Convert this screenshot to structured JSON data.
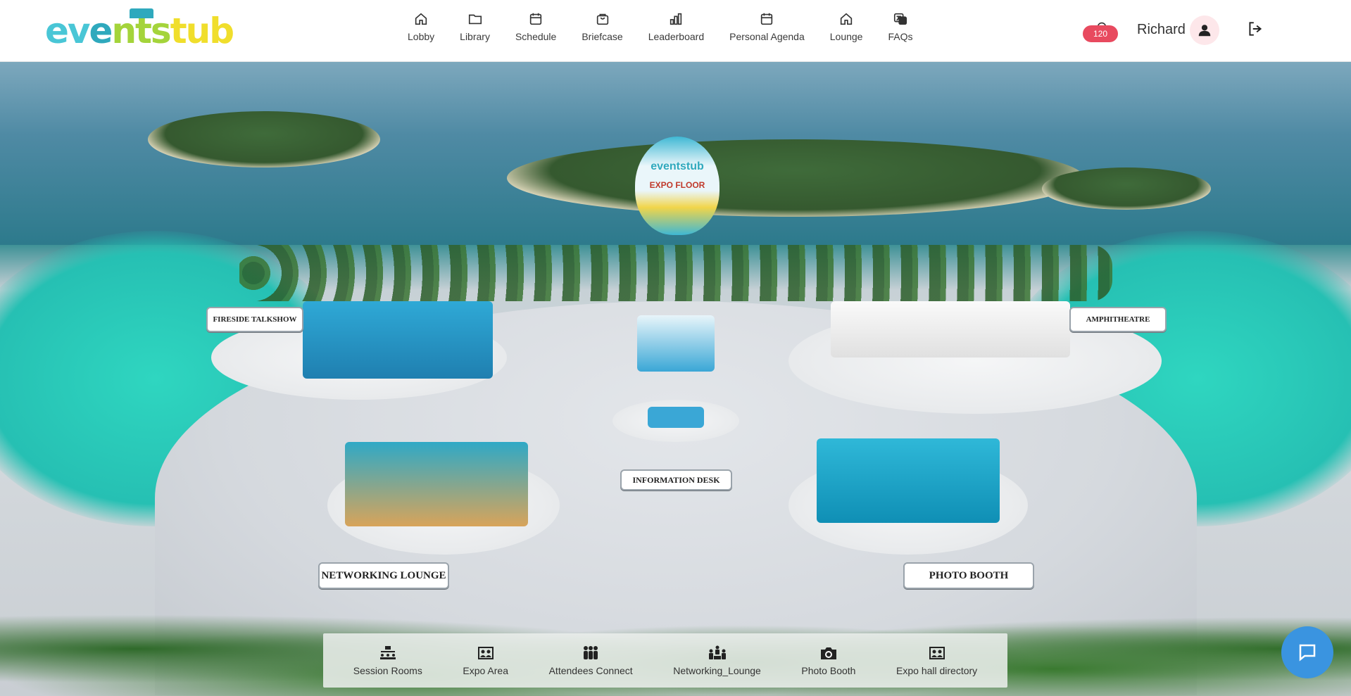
{
  "brand": {
    "logo_text_1": "ev",
    "logo_text_2": "e",
    "logo_text_3": "nts",
    "logo_text_4": "tub"
  },
  "nav": {
    "items": [
      {
        "label": "Lobby",
        "icon": "home-icon"
      },
      {
        "label": "Library",
        "icon": "folder-icon"
      },
      {
        "label": "Schedule",
        "icon": "calendar-icon"
      },
      {
        "label": "Briefcase",
        "icon": "bag-icon"
      },
      {
        "label": "Leaderboard",
        "icon": "bar-chart-icon"
      },
      {
        "label": "Personal Agenda",
        "icon": "calendar-icon"
      },
      {
        "label": "Lounge",
        "icon": "home-icon"
      },
      {
        "label": "FAQs",
        "icon": "translate-icon"
      }
    ]
  },
  "header": {
    "notification_count": "120",
    "user_name": "Richard"
  },
  "scene": {
    "balloon_logo": "eventstub",
    "balloon_sign": "EXPO FLOOR",
    "signs": {
      "fireside": "FIRESIDE TALKSHOW",
      "amphitheatre": "AMPHITHEATRE",
      "information": "INFORMATION DESK",
      "networking": "NETWORKING LOUNGE",
      "photo": "PHOTO BOOTH"
    }
  },
  "toolbar": {
    "items": [
      {
        "label": "Session Rooms",
        "icon": "session-rooms-icon"
      },
      {
        "label": "Expo Area",
        "icon": "expo-area-icon"
      },
      {
        "label": "Attendees Connect",
        "icon": "attendees-icon"
      },
      {
        "label": "Networking_Lounge",
        "icon": "networking-icon"
      },
      {
        "label": "Photo Booth",
        "icon": "camera-icon"
      },
      {
        "label": "Expo hall directory",
        "icon": "directory-icon"
      }
    ]
  },
  "colors": {
    "accent": "#3a94e0",
    "badge": "#e84a5f",
    "logo_cyan": "#49c6d6",
    "logo_green": "#a4d43b",
    "logo_yellow": "#f0de2c"
  }
}
